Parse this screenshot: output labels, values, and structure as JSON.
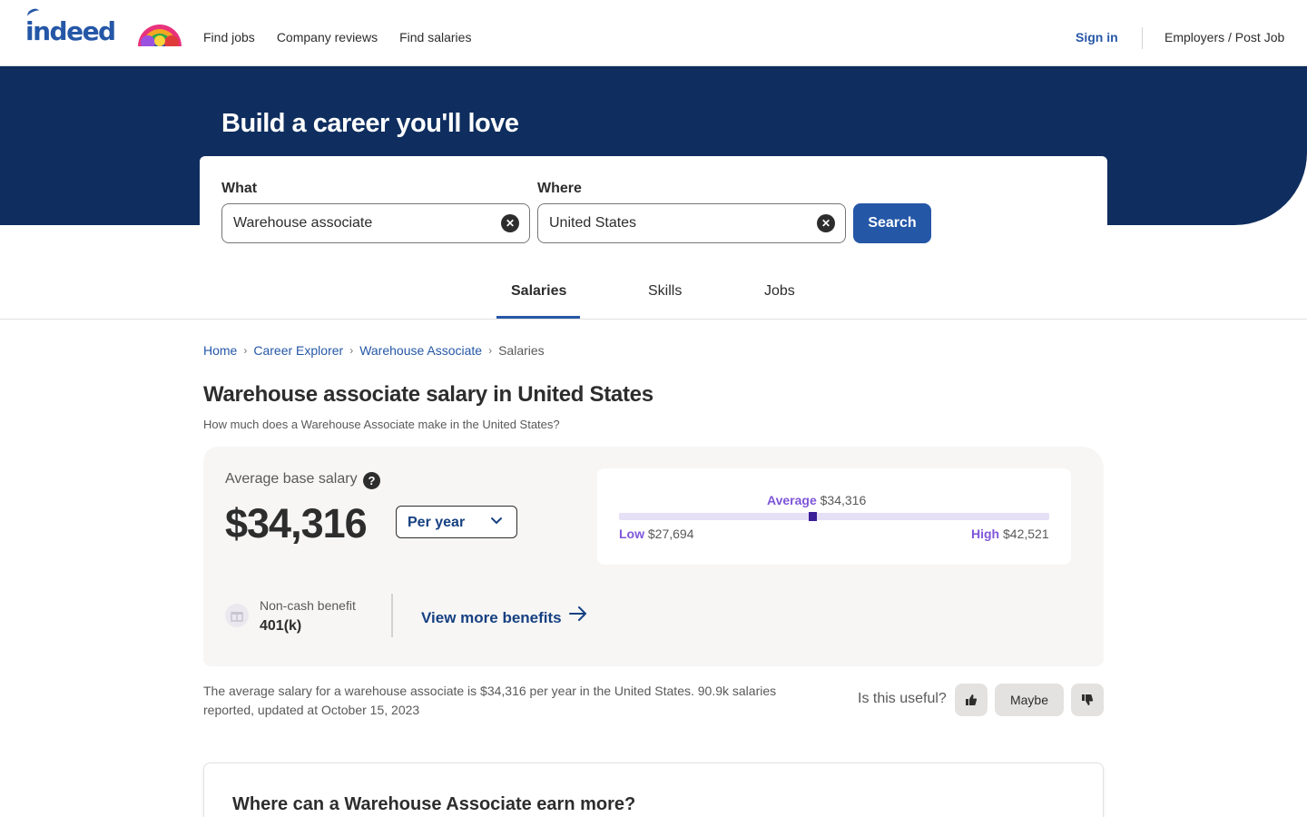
{
  "header": {
    "logo_text": "indeed",
    "nav": [
      "Find jobs",
      "Company reviews",
      "Find salaries"
    ],
    "sign_in": "Sign in",
    "employers": "Employers / Post Job"
  },
  "hero": {
    "title": "Build a career you'll love",
    "what_label": "What",
    "what_value": "Warehouse associate",
    "where_label": "Where",
    "where_value": "United States",
    "search_button": "Search"
  },
  "tabs": [
    "Salaries",
    "Skills",
    "Jobs"
  ],
  "active_tab": "Salaries",
  "breadcrumb": [
    "Home",
    "Career Explorer",
    "Warehouse Associate",
    "Salaries"
  ],
  "page": {
    "title": "Warehouse associate salary in United States",
    "subtitle": "How much does a Warehouse Associate make in the United States?"
  },
  "salary": {
    "avg_label": "Average base salary",
    "help": "?",
    "avg_value": "$34,316",
    "period": "Per year",
    "range": {
      "average_label": "Average",
      "average_value": "$34,316",
      "low_label": "Low",
      "low_value": "$27,694",
      "high_label": "High",
      "high_value": "$42,521",
      "average_position_fraction": 0.45
    },
    "benefit_label": "Non-cash benefit",
    "benefit_value": "401(k)",
    "view_more": "View more benefits"
  },
  "summary": "The average salary for a warehouse associate is $34,316 per year in the United States.  90.9k salaries reported, updated at October 15, 2023",
  "feedback": {
    "question": "Is this useful?",
    "maybe": "Maybe"
  },
  "next_section": {
    "title": "Where can a Warehouse Associate earn more?"
  },
  "colors": {
    "brand": "#2557a7",
    "hero_bg": "#0f2e5f",
    "range_accent": "#7f56d9"
  },
  "icons": [
    "rainbow-logo-icon",
    "clear-icon",
    "help-icon",
    "chevron-down-icon",
    "gift-icon",
    "arrow-right-icon",
    "thumbs-up-icon",
    "thumbs-down-icon"
  ]
}
